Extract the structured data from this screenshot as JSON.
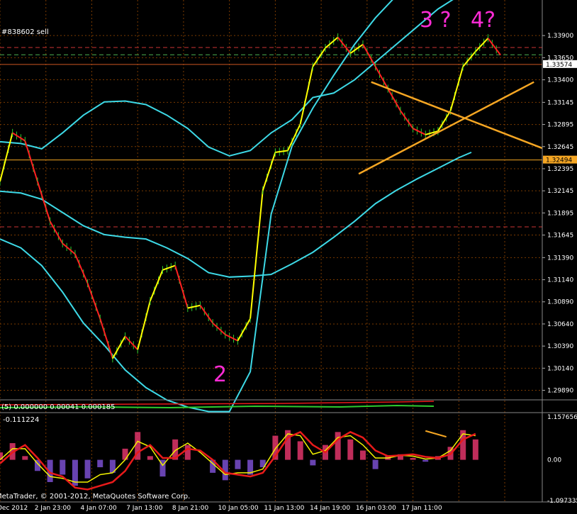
{
  "window": {
    "copyright": "MetaTrader, © 2001-2012, MetaQuotes Software Corp.",
    "order_label": "#838602 sell",
    "sub1_label": "(5) 0.000000 0.00041 0.000185",
    "sub2_label": "-0.111224"
  },
  "annotations": [
    {
      "text": "3 ?",
      "color": "#ff2bd6"
    },
    {
      "text": "4?",
      "color": "#ff2bd6"
    },
    {
      "text": "2",
      "color": "#ff2bd6"
    }
  ],
  "chart_data": [
    {
      "type": "line",
      "name": "main",
      "y_ticks": [
        "1.33900",
        "1.33650",
        "1.33400",
        "1.33145",
        "1.32895",
        "1.32645",
        "1.32395",
        "1.32145",
        "1.31895",
        "1.31645",
        "1.31390",
        "1.31140",
        "1.30890",
        "1.30640",
        "1.30390",
        "1.30140",
        "1.29890"
      ],
      "ylim": [
        1.2979,
        1.3427
      ],
      "price_tags": [
        {
          "value": "1.33574",
          "color": "#ffffff"
        },
        {
          "value": "1.32494",
          "color": "#f5a623"
        }
      ],
      "x_ticks": [
        "Dec 2012",
        "2 Jan 23:00",
        "4 Jan 07:00",
        "7 Jan 13:00",
        "8 Jan 21:00",
        "10 Jan 05:00",
        "11 Jan 13:00",
        "14 Jan 19:00",
        "16 Jan 03:00",
        "17 Jan 11:00"
      ],
      "hlines": [
        {
          "y": 1.33574,
          "color": "#cc5522",
          "style": "solid"
        },
        {
          "y": 1.32494,
          "color": "#f5a623",
          "style": "solid"
        },
        {
          "y": 1.33765,
          "color": "#cc3333",
          "style": "dashed"
        },
        {
          "y": 1.33683,
          "color": "#4caf50",
          "style": "dashed"
        },
        {
          "y": 1.31737,
          "color": "#cc3333",
          "style": "dashed"
        }
      ],
      "price": {
        "x": [
          0,
          3,
          6,
          9,
          12,
          15,
          18,
          21,
          24,
          27,
          30,
          33,
          36,
          39,
          42,
          45,
          48,
          51,
          54,
          57,
          60,
          63,
          66,
          69,
          72,
          75,
          78,
          81,
          84,
          87,
          90,
          93,
          96,
          99,
          102,
          105,
          108,
          111,
          114,
          117,
          120
        ],
        "y": [
          1.3225,
          1.328,
          1.3271,
          1.3225,
          1.318,
          1.3155,
          1.3143,
          1.311,
          1.307,
          1.3025,
          1.305,
          1.3035,
          1.309,
          1.3125,
          1.313,
          1.3082,
          1.3085,
          1.3065,
          1.3052,
          1.3045,
          1.307,
          1.3215,
          1.3258,
          1.326,
          1.329,
          1.3355,
          1.3376,
          1.3388,
          1.337,
          1.338,
          1.3355,
          1.333,
          1.3305,
          1.3285,
          1.3278,
          1.3282,
          1.3305,
          1.3355,
          1.3372,
          1.3387,
          1.3368
        ]
      },
      "ma_fast": {
        "x": [
          0,
          5,
          10,
          15,
          20,
          25,
          30,
          35,
          40,
          45,
          50,
          55,
          60,
          65,
          70,
          75,
          80,
          85,
          90,
          95,
          100,
          105,
          110,
          112
        ],
        "y": [
          1.316,
          1.315,
          1.313,
          1.31,
          1.3065,
          1.304,
          1.3012,
          1.2992,
          1.2978,
          1.297,
          1.2965,
          1.2965,
          1.301,
          1.3188,
          1.3265,
          1.3308,
          1.3345,
          1.338,
          1.341,
          1.3435,
          1.346,
          1.348,
          1.35,
          1.351
        ]
      },
      "ma_mid": {
        "x": [
          0,
          5,
          10,
          15,
          20,
          25,
          30,
          35,
          40,
          45,
          50,
          55,
          60,
          65,
          70,
          75,
          80,
          85,
          90,
          95,
          100,
          105,
          110,
          113
        ],
        "y": [
          1.327,
          1.3268,
          1.3262,
          1.328,
          1.33,
          1.3315,
          1.3316,
          1.3312,
          1.33,
          1.3285,
          1.3264,
          1.3254,
          1.326,
          1.328,
          1.3295,
          1.332,
          1.3325,
          1.334,
          1.336,
          1.338,
          1.34,
          1.342,
          1.3435,
          1.3445
        ]
      },
      "ma_slow": {
        "x": [
          0,
          5,
          10,
          15,
          20,
          25,
          30,
          35,
          40,
          45,
          50,
          55,
          60,
          65,
          70,
          75,
          80,
          85,
          90,
          95,
          100,
          105,
          110,
          113
        ],
        "y": [
          1.3214,
          1.3212,
          1.3205,
          1.319,
          1.3175,
          1.3165,
          1.3162,
          1.316,
          1.315,
          1.3138,
          1.3122,
          1.3117,
          1.3118,
          1.312,
          1.3132,
          1.3145,
          1.3162,
          1.318,
          1.32,
          1.3215,
          1.3228,
          1.324,
          1.3252,
          1.3258
        ]
      },
      "trendlines": [
        {
          "x1": 89,
          "y1": 1.33375,
          "x2": 130,
          "y2": 1.32627
        },
        {
          "x1": 86,
          "y1": 1.32337,
          "x2": 128,
          "y2": 1.33375
        }
      ]
    },
    {
      "type": "bar",
      "name": "oscillator",
      "y_ticks": [
        "1.157656",
        "0.00",
        "-1.097335"
      ],
      "ylim": [
        -1.097335,
        1.157656
      ],
      "x": [
        0,
        3,
        6,
        9,
        12,
        15,
        18,
        21,
        24,
        27,
        30,
        33,
        36,
        39,
        42,
        45,
        48,
        51,
        54,
        57,
        60,
        63,
        66,
        69,
        72,
        75,
        78,
        81,
        84,
        87,
        90,
        93,
        96,
        99,
        102,
        105,
        108,
        111,
        114
      ],
      "values": [
        0.2,
        0.45,
        0.1,
        -0.3,
        -0.6,
        -0.4,
        -0.7,
        -0.5,
        -0.2,
        -0.35,
        0.3,
        0.75,
        0.1,
        -0.45,
        0.55,
        0.4,
        0.0,
        -0.35,
        -0.55,
        -0.25,
        -0.4,
        -0.2,
        0.65,
        0.8,
        0.5,
        -0.15,
        0.4,
        0.75,
        0.55,
        0.25,
        -0.25,
        0.1,
        0.15,
        0.05,
        -0.05,
        0.1,
        0.35,
        0.8,
        0.55
      ],
      "signal": [
        0.0,
        0.3,
        0.3,
        -0.1,
        -0.45,
        -0.5,
        -0.6,
        -0.6,
        -0.4,
        -0.35,
        0.0,
        0.5,
        0.35,
        -0.15,
        0.25,
        0.45,
        0.2,
        -0.1,
        -0.4,
        -0.35,
        -0.35,
        -0.25,
        0.3,
        0.7,
        0.65,
        0.15,
        0.25,
        0.6,
        0.65,
        0.4,
        0.05,
        0.05,
        0.12,
        0.1,
        0.02,
        0.05,
        0.25,
        0.7,
        0.65
      ],
      "signal2": [
        -0.1,
        0.2,
        0.4,
        0.05,
        -0.35,
        -0.45,
        -0.75,
        -0.8,
        -0.7,
        -0.6,
        -0.3,
        0.2,
        0.4,
        0.05,
        0.05,
        0.3,
        0.25,
        0.0,
        -0.35,
        -0.4,
        -0.45,
        -0.35,
        0.1,
        0.6,
        0.75,
        0.4,
        0.2,
        0.55,
        0.75,
        0.6,
        0.25,
        0.1,
        0.12,
        0.15,
        0.08,
        0.05,
        0.15,
        0.55,
        0.7
      ]
    }
  ],
  "colors": {
    "grid": "#7a3a00",
    "price_up": "#ffff00",
    "price_down": "#ff2020",
    "wick": "#2ecc2e",
    "ma": "#3dd9e6",
    "trend": "#f5a623",
    "hist_up": "#e0356a",
    "hist_down": "#7a4fd0",
    "signal": "#f2f200",
    "signal2": "#e81a1a"
  }
}
